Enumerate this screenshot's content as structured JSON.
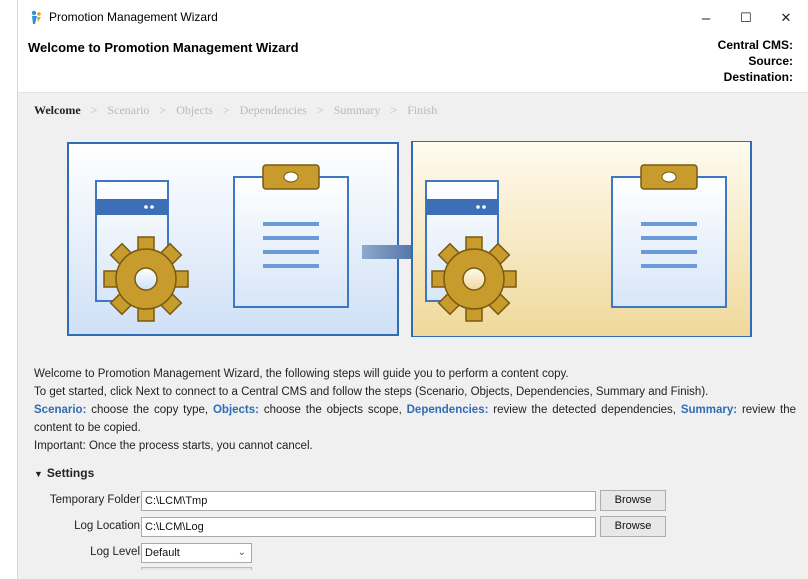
{
  "window": {
    "title": "Promotion Management Wizard",
    "controls": {
      "minimize": "–",
      "maximize": "☐",
      "close": "✕"
    }
  },
  "header": {
    "title": "Welcome to Promotion Management Wizard",
    "central_cms_label": "Central CMS:",
    "source_label": "Source:",
    "destination_label": "Destination:"
  },
  "breadcrumb": {
    "separator": ">",
    "steps": [
      "Welcome",
      "Scenario",
      "Objects",
      "Dependencies",
      "Summary",
      "Finish"
    ],
    "active_index": 0
  },
  "graphic": {
    "icons": [
      "source-system-icon",
      "copy-arrow-icon",
      "destination-system-icon"
    ],
    "colors": {
      "left_panel": "#dce9f9",
      "right_panel": "#f4e3b0",
      "arrow": "#4d73a8",
      "gear": "#c9a02e",
      "frame": "#2f6cb5"
    }
  },
  "description": {
    "line1": "Welcome to Promotion Management Wizard, the following steps will guide you to perform a content copy.",
    "line2": "To get started, click Next to connect to a Central CMS and follow the steps (Scenario, Objects, Dependencies, Summary and Finish).",
    "scenario_label": "Scenario:",
    "scenario_text": " choose the copy type, ",
    "objects_label": "Objects:",
    "objects_text": " choose the objects scope, ",
    "dependencies_label": "Dependencies:",
    "dependencies_text": " review the detected dependencies, ",
    "summary_label": "Summary:",
    "summary_text": " review the content to be copied.",
    "line4": "Important: Once the process starts, you cannot cancel."
  },
  "settings": {
    "heading": "Settings",
    "temp_folder_label": "Temporary Folder",
    "temp_folder_value": "C:\\LCM\\Tmp",
    "log_location_label": "Log Location",
    "log_location_value": "C:\\LCM\\Log",
    "browse_label": "Browse",
    "log_level_label": "Log Level",
    "log_level_value": "Default"
  },
  "accent_color": "#2f6cb5"
}
